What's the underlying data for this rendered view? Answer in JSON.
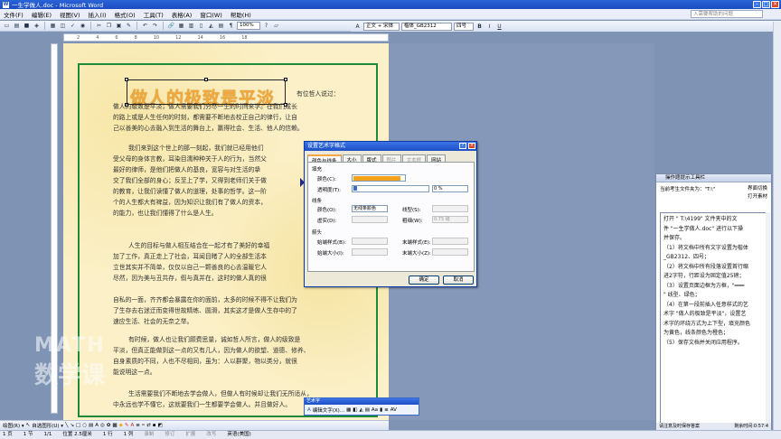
{
  "window": {
    "title": "一生学做人.doc - Microsoft Word"
  },
  "menu": [
    "文件(F)",
    "编辑(E)",
    "视图(V)",
    "插入(I)",
    "格式(O)",
    "工具(T)",
    "表格(A)",
    "窗口(W)",
    "帮助(H)"
  ],
  "help_box": "入需要帮助的问题",
  "toolbar": {
    "zoom": "100%",
    "style": "正文 + 宋体",
    "font": "楷体_GB2312",
    "size": "四号",
    "bold": "B",
    "italic": "I",
    "underline": "U"
  },
  "ruler_marks": [
    "2",
    "4",
    "6",
    "8",
    "10",
    "12",
    "14",
    "16",
    "18"
  ],
  "document": {
    "wordart": "做人的极致是平淡",
    "lines": [
      "有位哲人说过：",
      "做人的级致是平淡，做人需要我们穷尽一生的时间来学。在我们成长",
      "的路上或是人生任何的时刻，都需要不断地去校正自己的律行，让自",
      "己以善美的心去融入到生活的舞台上，赢得社会、生活、他人的信赖。",
      "我们来到这个世上的那一刻起，我们就已经用他们",
      "受父母的身体言教，耳染目濡种种关于人的行为，当然父",
      "最好的律师，是他们把做人的基良，宽容与对生活的挚",
      "交了我们全部的身心；反至上了学，又得到老师们关于做",
      "的教育，让我们读懂了做人的道理，处事的哲学。这一阶",
      "个的人生都大有裨益，因为知识让我们有了做人的资本，",
      "的能力，也让我们懂得了什么是人生。",
      "人生的目标与做人相互结合在一起才有了美好的幸福",
      "加了工作，真正走上了社会，耳闻目睹了人的全部生活本",
      "立世其实并不简单，仅仅以自己一颗善良的心去温暖它人",
      "尽然，因为美与丑共存，假与真并在，这时的做人真的很",
      "自私的一面，齐齐都会暴露在你的面前，太多的时候不得不让我们为",
      "了生存去右迷迂而变得世故精练、圆滑，其实这才是做人生存中的了",
      "速应生活、社会的无奈之举。",
      "有时候，做人也让我们颇费思量，诚如哲人所言，做人的级致是",
      "平淡，但真正能做到这一点的又有几人，因为做人的欲望、道德、修养、",
      "自身素质的不同，人也不尽相同，虽为：人以群聚，物以类分，就很",
      "能说明这一点。",
      "生活需要我们不断地去学会做人，但做人有时候却让我们无所适从，",
      "中永远也学不懂它，这就要我们一生都要学会做人。并且做好人。"
    ]
  },
  "dialog": {
    "title": "设置艺术字格式",
    "tabs": [
      "颜色与线条",
      "大小",
      "版式",
      "图片",
      "文本框",
      "网站"
    ],
    "fill_group": "填充",
    "color_label": "颜色(C):",
    "transparency_label": "透明度(T):",
    "transparency_value": "0 %",
    "line_group": "线条",
    "line_color_label": "颜色(O):",
    "line_color_value": "无线条颜色",
    "line_style_label": "线型(S):",
    "dash_label": "虚实(D):",
    "weight_label": "粗细(W):",
    "weight_value": "0.75 磅",
    "arrow_group": "箭头",
    "begin_style_label": "始端样式(B):",
    "end_style_label": "末端样式(E):",
    "begin_size_label": "始端大小(I):",
    "end_size_label": "末端大小(Z):",
    "ok": "确定",
    "cancel": "取消",
    "fill_color": "#f5a21a"
  },
  "task_pane": {
    "title": "操作题提示工具栏",
    "current_file_label": "当前考生文件夹为：\"T:\\\"",
    "switch_button": "界面切换",
    "open_button": "打开素材",
    "instructions": [
      "打开 \" T:\\4199\" 文件夹中的文",
      "件 \"一生学做人.doc\" 进行以下操",
      "并保存。",
      "（1）将文档中所有文字设置为楷体",
      "_GB2312、四号；",
      "（2）将文档中所有段落设置首行缩",
      "进2字符，行距设为固定值25磅；",
      "（3）设置页面边框为方框，\"━━━",
      "\" 线型、绿色；",
      "（4）在第一段前插入任意样式的艺",
      "术字 \"做人的极致是平淡\"，设置艺",
      "术字的环绕方式为上下型，填充颜色",
      "为黄色，线条颜色为橙色；",
      "（5）保存文档并关闭应用程序。"
    ],
    "footer_left": "请注意及时保存答案",
    "footer_right": "剩余时间:0:57:4"
  },
  "wordart_toolbar": {
    "title": "艺术字",
    "edit_label": "编辑文字(X)..."
  },
  "drawbar": {
    "draw": "绘图(R) ▾",
    "autoshape": "自选图形(U) ▾"
  },
  "status": [
    "1 页",
    "1 节",
    "1/1",
    "位置 2.5厘米",
    "1 行",
    "1 列",
    "录制",
    "修订",
    "扩展",
    "改写",
    "英语(美国)"
  ],
  "watermark": {
    "line1": "MATH",
    "line2": "数学课"
  }
}
